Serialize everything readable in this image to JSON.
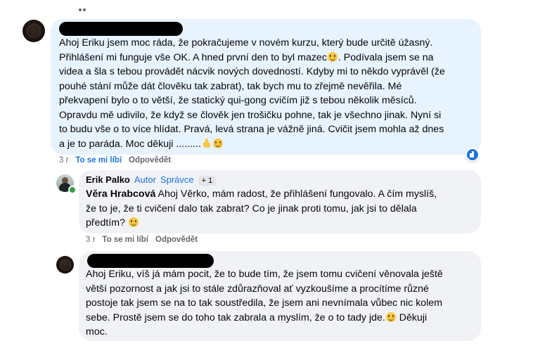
{
  "comment1": {
    "text_lines": [
      "Ahoj Eriku jsem moc ráda, že pokračujeme v novém kurzu, který bude určitě úžasný.",
      "Přihlášení mi funguje vše OK. A hned první den to byl mazec",
      ". Podívala jsem se na",
      "videa a šla s tebou provádět nácvik nových dovedností. Kdyby mi to někdo vyprávěl (že",
      "pouhé stání může dát člověku tak zabrat), tak bych mu to zřejmě nevěřila. Mé",
      "překvapení bylo o to větší, že statický qui-gong cvičím již s tebou několik měsíců.",
      "Opravdu mě udivilo, že když se člověk jen trošičku pohne, tak je všechno jinak. Nyní si",
      "to budu vše o to více hlídat. Pravá, levá strana je vážně jiná. Cvičit jsem mohla až dnes",
      "a je to paráda. Moc děkuji ........."
    ],
    "time": "3 r",
    "like_label": "To se mi líbí",
    "reply_label": "Odpovědět",
    "emoji_names": [
      "grinning-emoji",
      "thumbs-up-emoji",
      "grinning-emoji"
    ]
  },
  "comment2": {
    "author": "Erik Palko",
    "tag_author": "Autor",
    "tag_admin": "Správce",
    "tag_more": "+ 1",
    "mention": "Věra Hrabcová",
    "text_line1_rest": " Ahoj Věrko, mám radost, že přihlášení fungovalo. A čím myslíš,",
    "text_line2": "že to je, že ti cvičení dalo tak zabrat? Co je jinak proti tomu, jak jsi to dělala",
    "text_line3": "předtím? ",
    "time": "3 r",
    "like_label": "To se mi líbí",
    "reply_label": "Odpovědět"
  },
  "comment3": {
    "text_lines": [
      "Ahoj Eriku, víš já mám pocit, že to bude tím, že jsem tomu cvičení věnovala ještě",
      "větší pozornost a jak jsi to stále zdůrazňoval ať vyzkoušíme a procítíme různé",
      "postoje tak jsem se na to tak soustředila, že jsem ani nevnímala vůbec nic kolem",
      "sebe. Prostě jsem se do toho tak zabrala a myslím, že o to tady jde.",
      " Děkuji",
      "moc."
    ]
  },
  "colors": {
    "accent": "#1b74e4",
    "bubble_gray": "#f0f2f5",
    "bubble_highlight": "#e7f3ff",
    "secondary_text": "#65676b",
    "online": "#31a24c"
  },
  "icons": [
    "like-reaction-icon",
    "online-status-icon"
  ]
}
